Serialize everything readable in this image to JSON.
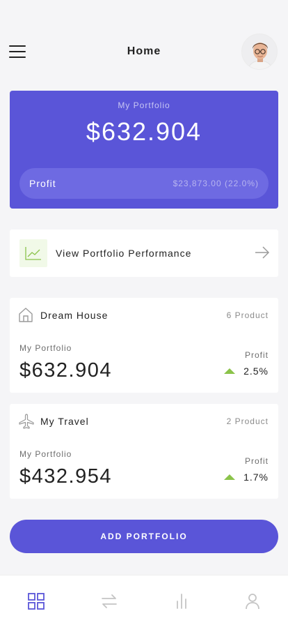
{
  "header": {
    "title": "Home",
    "menu_icon": "hamburger-menu-icon",
    "avatar": "user-avatar"
  },
  "summary": {
    "label": "My Portfolio",
    "value": "$632.904",
    "profit_label": "Profit",
    "profit_value": "$23,873.00 (22.0%)"
  },
  "performance": {
    "label": "View Portfolio Performance",
    "icon": "chart-line-icon",
    "arrow_icon": "arrow-right-icon"
  },
  "portfolios": [
    {
      "title": "Dream House",
      "icon": "house-icon",
      "count": "6 Product",
      "sub_label": "My Portfolio",
      "value": "$632.904",
      "profit_label": "Profit",
      "profit_pct": "2.5%"
    },
    {
      "title": "My Travel",
      "icon": "airplane-icon",
      "count": "2 Product",
      "sub_label": "My Portfolio",
      "value": "$432.954",
      "profit_label": "Profit",
      "profit_pct": "1.7%"
    }
  ],
  "add_button": {
    "label": "ADD  PORTFOLIO"
  },
  "nav": {
    "items": [
      {
        "icon": "grid-icon",
        "active": true
      },
      {
        "icon": "transfer-icon",
        "active": false
      },
      {
        "icon": "bar-chart-icon",
        "active": false
      },
      {
        "icon": "profile-icon",
        "active": false
      }
    ]
  },
  "colors": {
    "accent": "#5a55d8",
    "accent_light": "#6e6ae2",
    "positive": "#8bc34a",
    "nav_inactive": "#c4c4c4"
  }
}
